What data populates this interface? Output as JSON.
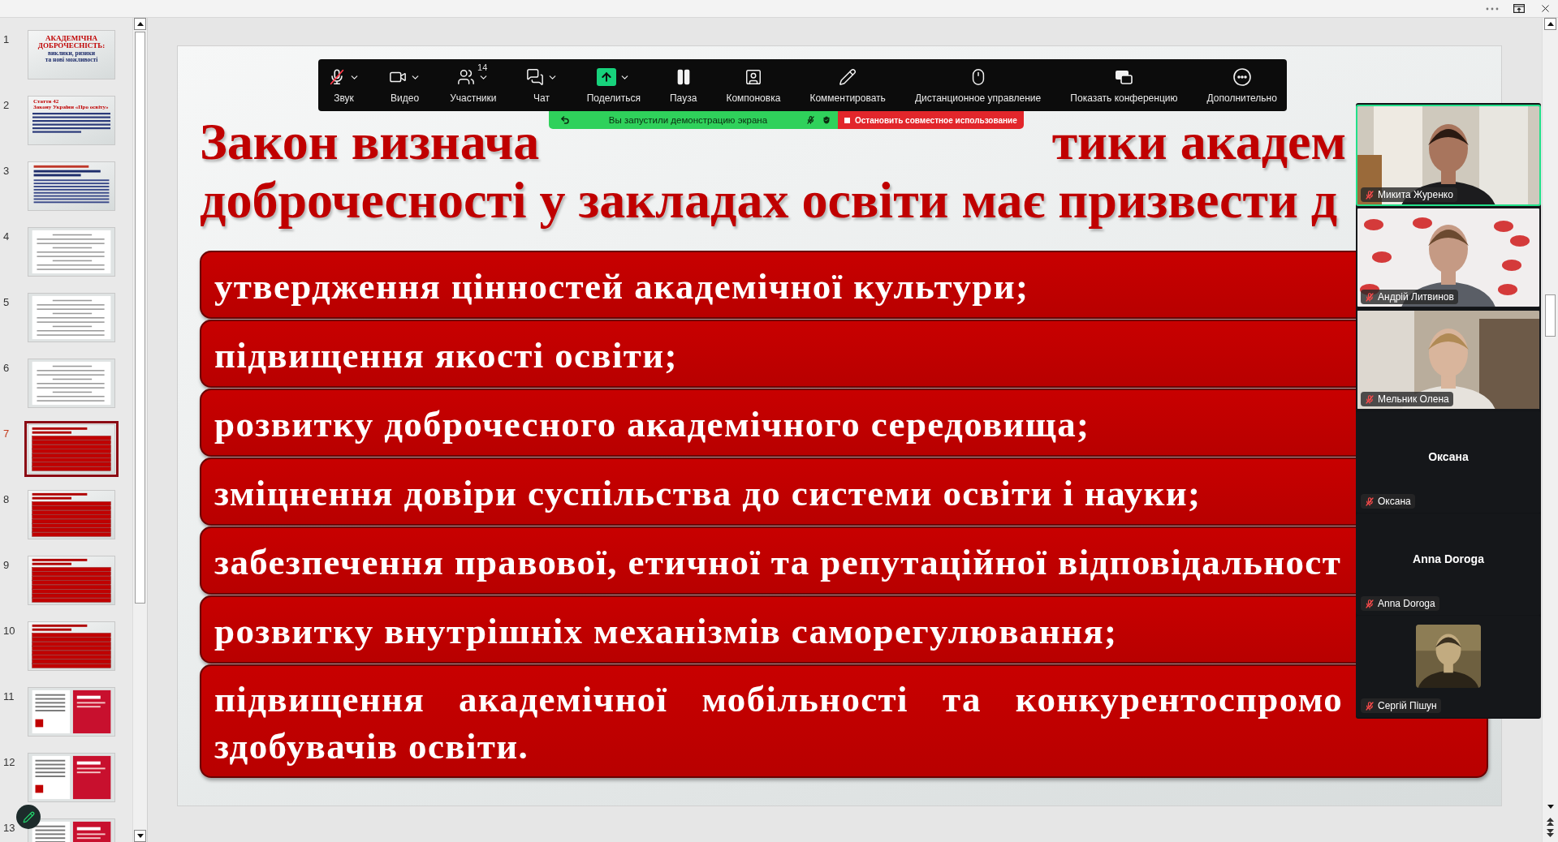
{
  "slides_panel": {
    "slides": [
      {
        "number": "1",
        "selected": false,
        "kind": "title",
        "lines": [
          "АКАДЕМІЧНА",
          "ДОБРОЧЕСНІСТЬ:",
          "виклики, ризики",
          "та нові можливості"
        ]
      },
      {
        "number": "2",
        "selected": false,
        "kind": "text",
        "lines": [
          "Стаття 42",
          "Закону України «Про освіту»"
        ]
      },
      {
        "number": "3",
        "selected": false,
        "kind": "list"
      },
      {
        "number": "4",
        "selected": false,
        "kind": "doc"
      },
      {
        "number": "5",
        "selected": false,
        "kind": "doc"
      },
      {
        "number": "6",
        "selected": false,
        "kind": "doc"
      },
      {
        "number": "7",
        "selected": true,
        "kind": "red"
      },
      {
        "number": "8",
        "selected": false,
        "kind": "red"
      },
      {
        "number": "9",
        "selected": false,
        "kind": "red"
      },
      {
        "number": "10",
        "selected": false,
        "kind": "red"
      },
      {
        "number": "11",
        "selected": false,
        "kind": "cards"
      },
      {
        "number": "12",
        "selected": false,
        "kind": "cards"
      },
      {
        "number": "13",
        "selected": false,
        "kind": "cards"
      }
    ]
  },
  "slide": {
    "title": {
      "line_1_left": "Закон визнача",
      "line_1_right": "тики академ",
      "line_2": "доброчесності у закладах освіти має призвести д"
    },
    "bullets": [
      {
        "lines": [
          "утвердження цінностей академічної культури;"
        ]
      },
      {
        "lines": [
          "підвищення якості освіти;"
        ]
      },
      {
        "lines": [
          "розвитку доброчесного академічного середовища;"
        ]
      },
      {
        "lines": [
          "зміцнення довіри суспільства до системи освіти і науки;"
        ]
      },
      {
        "lines": [
          "забезпечення правової, етичної та репутаційної відповідальност"
        ]
      },
      {
        "lines": [
          "розвитку внутрішніх механізмів саморегулювання;"
        ]
      },
      {
        "lines": [
          "підвищення академічної мобільності та конкурентоспромо",
          "здобувачів освіти."
        ]
      }
    ]
  },
  "toolbar": {
    "mic_muted": true,
    "items": [
      {
        "label": "Звук",
        "caret": true
      },
      {
        "label": "Видео",
        "caret": true
      },
      {
        "label": "Участники",
        "caret": true,
        "badge": "14"
      },
      {
        "label": "Чат",
        "caret": true
      },
      {
        "label": "Поделиться",
        "caret": true
      },
      {
        "label": "Пауза",
        "caret": false
      },
      {
        "label": "Компоновка",
        "caret": false
      },
      {
        "label": "Комментировать",
        "caret": false
      },
      {
        "label": "Дистанционное управление",
        "caret": false
      },
      {
        "label": "Показать конференцию",
        "caret": false
      },
      {
        "label": "Дополнительно",
        "caret": false
      }
    ]
  },
  "share_banner": {
    "text": "Вы запустили демонстрацию экрана",
    "stop_button": "Остановить совместное использование"
  },
  "participants": [
    {
      "name": "Микита Журенко",
      "kind": "video",
      "speaking": true,
      "muted": true
    },
    {
      "name": "Андрій Литвинов",
      "kind": "video",
      "speaking": false,
      "muted": true
    },
    {
      "name": "Мельник Олена",
      "kind": "video",
      "speaking": false,
      "muted": true
    },
    {
      "name": "Оксана",
      "kind": "name",
      "display_name": "Оксана",
      "speaking": false,
      "muted": true
    },
    {
      "name": "Anna Doroga",
      "kind": "name",
      "display_name": "Anna Doroga",
      "speaking": false,
      "muted": true
    },
    {
      "name": "Сергій Пішун",
      "kind": "avatar",
      "speaking": false,
      "muted": true
    }
  ]
}
